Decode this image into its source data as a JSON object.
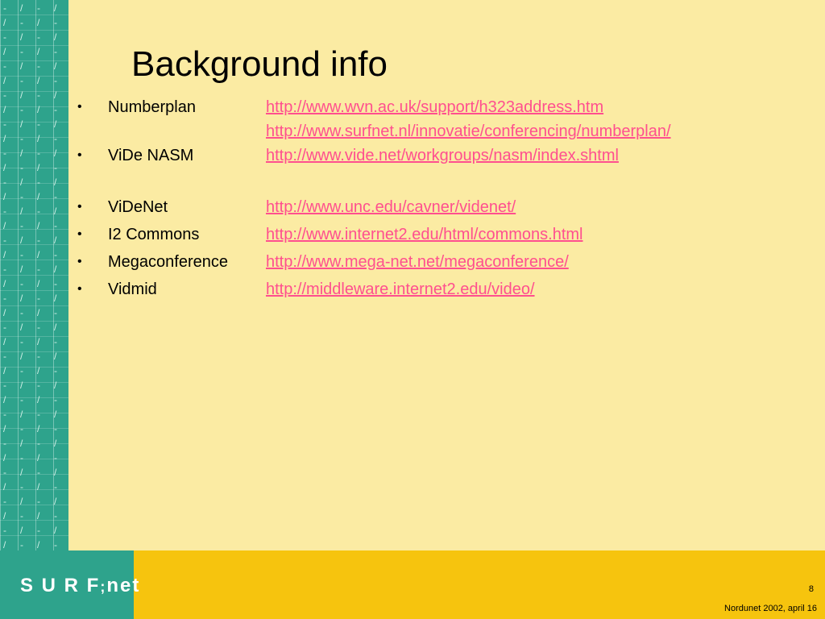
{
  "slide": {
    "title": "Background info",
    "items": [
      {
        "label": "Numberplan",
        "links": [
          "http://www.wvn.ac.uk/support/h323address.htm",
          "http://www.surfnet.nl/innovatie/conferencing/numberplan/"
        ]
      },
      {
        "label": "ViDe NASM",
        "links": [
          "http://www.vide.net/workgroups/nasm/index.shtml"
        ]
      },
      {
        "label": "ViDeNet",
        "links": [
          "http://www.unc.edu/cavner/videnet/"
        ]
      },
      {
        "label": "I2 Commons",
        "links": [
          "http://www.internet2.edu/html/commons.html"
        ]
      },
      {
        "label": "Megaconference",
        "links": [
          "http://www.mega-net.net/megaconference/"
        ]
      },
      {
        "label": "Vidmid",
        "links": [
          "http://middleware.internet2.edu/video/"
        ]
      }
    ],
    "bullet": "•",
    "page_number": "8",
    "footer": "Nordunet 2002, april 16",
    "logo": "SURF net"
  },
  "colors": {
    "background": "#FBEBA3",
    "stripe": "#2EA38C",
    "bottom_bar": "#F6C40E",
    "link": "#FF4F8F"
  }
}
